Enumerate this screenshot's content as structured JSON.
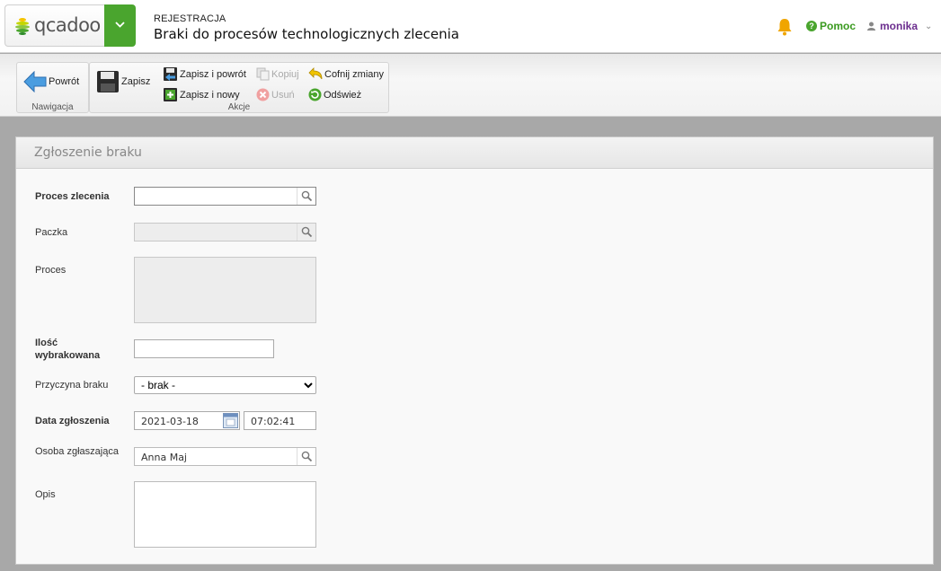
{
  "header": {
    "logo_text": "qcadoo",
    "section": "REJESTRACJA",
    "title": "Braki do procesów technologicznych zlecenia",
    "help_label": "Pomoc",
    "user_name": "monika"
  },
  "ribbon": {
    "navigation": {
      "label": "Nawigacja",
      "back": "Powrót"
    },
    "actions": {
      "label": "Akcje",
      "save": "Zapisz",
      "save_back": "Zapisz i powrót",
      "save_new": "Zapisz i nowy",
      "copy": "Kopiuj",
      "delete": "Usuń",
      "undo": "Cofnij zmiany",
      "refresh": "Odśwież"
    }
  },
  "form": {
    "title": "Zgłoszenie braku",
    "process_order_label": "Proces zlecenia",
    "process_order_value": "",
    "package_label": "Paczka",
    "package_value": "",
    "process_label": "Proces",
    "quantity_label_1": "Ilość",
    "quantity_label_2": "wybrakowana",
    "quantity_value": "",
    "reason_label": "Przyczyna braku",
    "reason_selected": "- brak -",
    "date_label": "Data zgłoszenia",
    "date_value": "2021-03-18",
    "time_value": "07:02:41",
    "reporter_label": "Osoba zgłaszająca",
    "reporter_value": "Anna Maj",
    "description_label": "Opis"
  },
  "colors": {
    "brand_green": "#4aa52e",
    "user_purple": "#6b2d8e",
    "bell_orange": "#f0a500"
  }
}
